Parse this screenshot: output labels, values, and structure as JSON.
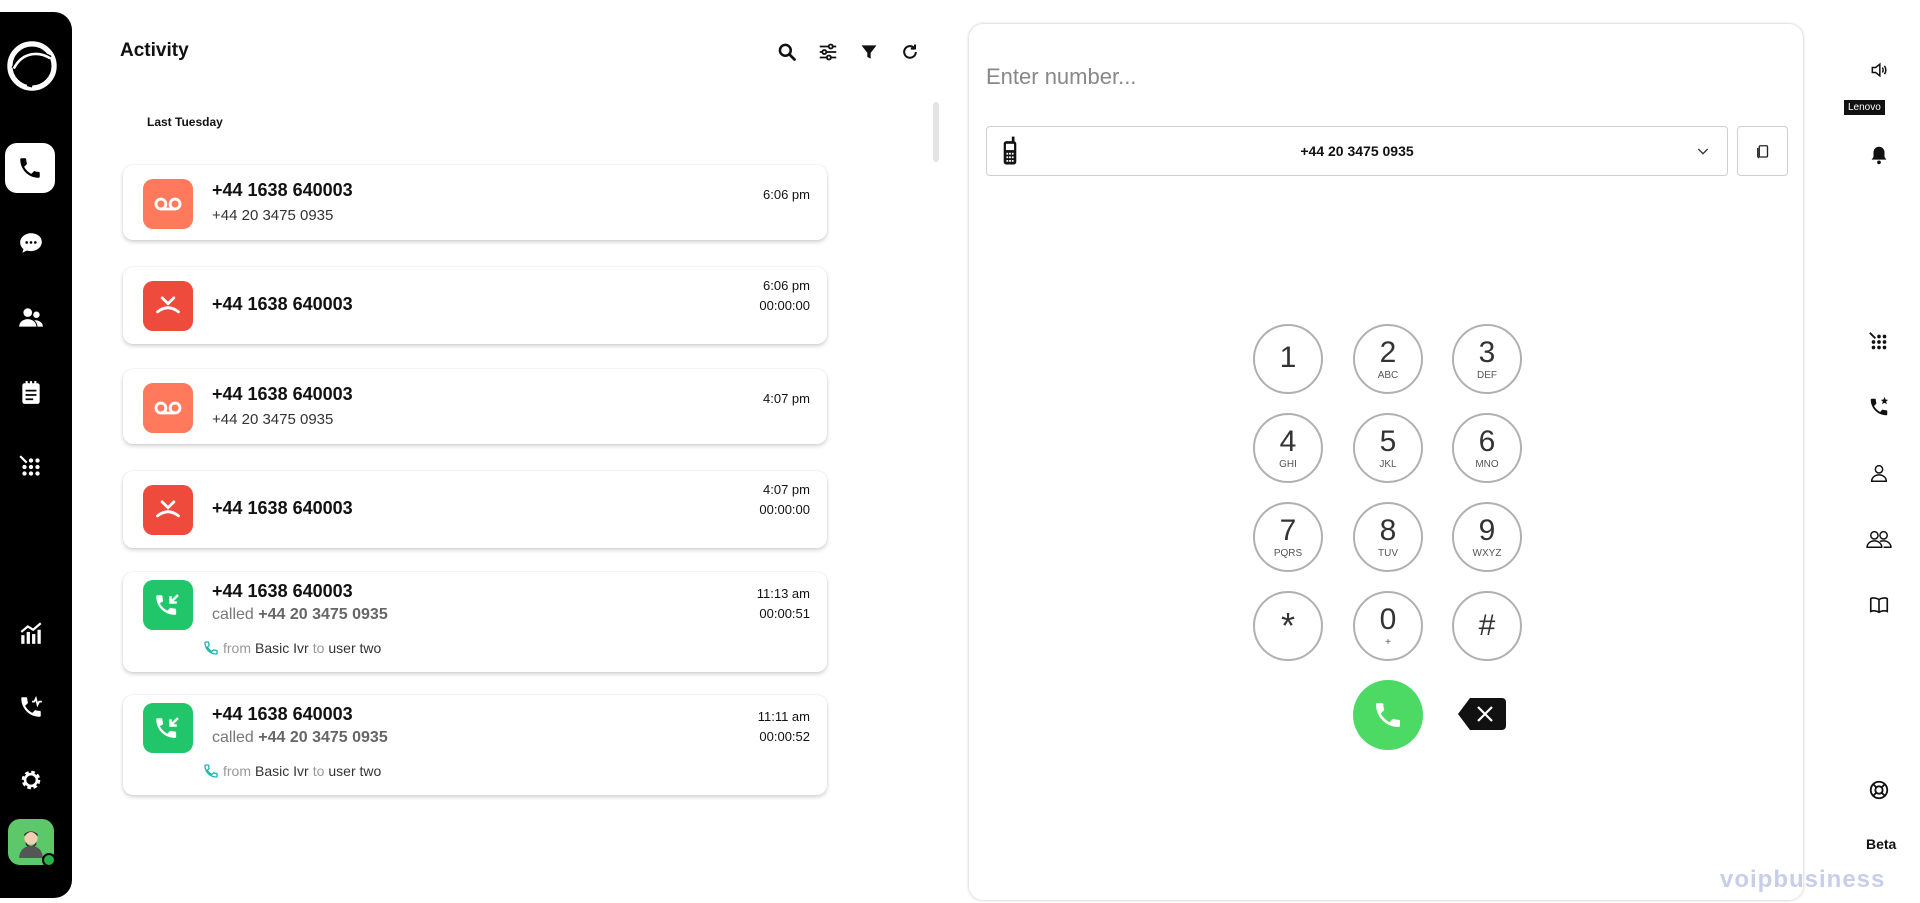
{
  "nav": {
    "items": [
      "logo",
      "calls",
      "chat",
      "contacts",
      "notes",
      "dialpad",
      "analytics",
      "call-activity",
      "settings"
    ],
    "active": "calls"
  },
  "activity": {
    "title": "Activity",
    "date_group": "Last Tuesday",
    "calls": [
      {
        "type": "voicemail",
        "color": "#ff7a5c",
        "number": "+44 1638 640003",
        "sub": "+44 20 3475 0935",
        "time": "6:06 pm",
        "duration": ""
      },
      {
        "type": "missed",
        "color": "#ef4b3c",
        "number": "+44 1638 640003",
        "sub": "",
        "time": "6:06 pm",
        "duration": "00:00:00"
      },
      {
        "type": "voicemail",
        "color": "#ff7a5c",
        "number": "+44 1638 640003",
        "sub": "+44 20 3475 0935",
        "time": "4:07 pm",
        "duration": ""
      },
      {
        "type": "missed",
        "color": "#ef4b3c",
        "number": "+44 1638 640003",
        "sub": "",
        "time": "4:07 pm",
        "duration": "00:00:00"
      },
      {
        "type": "incoming",
        "color": "#22c66a",
        "number": "+44 1638 640003",
        "called_label": "called",
        "called_number": "+44 20 3475 0935",
        "time": "11:13 am",
        "duration": "00:00:51",
        "from_label": "from",
        "from": "Basic Ivr",
        "to_label": "to",
        "to": "user two"
      },
      {
        "type": "incoming",
        "color": "#22c66a",
        "number": "+44 1638 640003",
        "called_label": "called",
        "called_number": "+44 20 3475 0935",
        "time": "11:11 am",
        "duration": "00:00:52",
        "from_label": "from",
        "from": "Basic Ivr",
        "to_label": "to",
        "to": "user two"
      }
    ]
  },
  "dialer": {
    "placeholder": "Enter number...",
    "caller_id": "+44 20 3475 0935",
    "keys": [
      {
        "d": "1",
        "l": ""
      },
      {
        "d": "2",
        "l": "ABC"
      },
      {
        "d": "3",
        "l": "DEF"
      },
      {
        "d": "4",
        "l": "GHI"
      },
      {
        "d": "5",
        "l": "JKL"
      },
      {
        "d": "6",
        "l": "MNO"
      },
      {
        "d": "7",
        "l": "PQRS"
      },
      {
        "d": "8",
        "l": "TUV"
      },
      {
        "d": "9",
        "l": "WXYZ"
      },
      {
        "d": "*",
        "l": ""
      },
      {
        "d": "0",
        "l": "+"
      },
      {
        "d": "#",
        "l": ""
      }
    ],
    "call_color": "#4cd964"
  },
  "right_rail": {
    "device": "Lenovo",
    "beta": "Beta"
  },
  "watermark": "voipbusiness"
}
